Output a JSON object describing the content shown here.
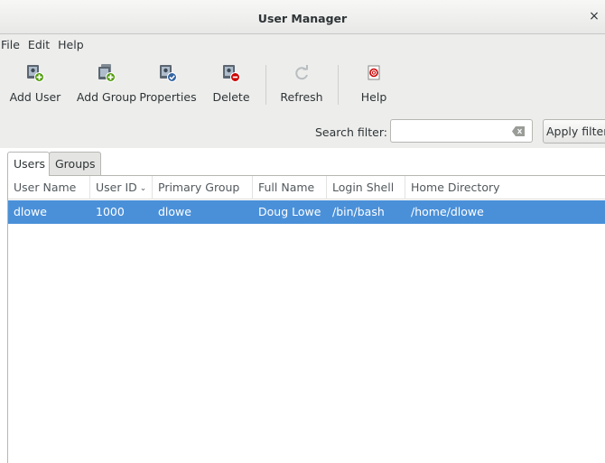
{
  "window": {
    "title": "User Manager",
    "close_glyph": "×"
  },
  "menubar": {
    "items": [
      "File",
      "Edit",
      "Help"
    ]
  },
  "toolbar": {
    "buttons": [
      {
        "label": "Add User",
        "icon": "add-user-icon"
      },
      {
        "label": "Add Group",
        "icon": "add-group-icon"
      },
      {
        "label": "Properties",
        "icon": "properties-icon"
      },
      {
        "label": "Delete",
        "icon": "delete-icon"
      },
      {
        "label": "Refresh",
        "icon": "refresh-icon"
      },
      {
        "label": "Help",
        "icon": "help-icon"
      }
    ]
  },
  "filter": {
    "label": "Search filter:",
    "value": "",
    "apply_label": "Apply filter"
  },
  "tabs": [
    "Users",
    "Groups"
  ],
  "active_tab": "Users",
  "table": {
    "columns": [
      "User Name",
      "User ID",
      "Primary Group",
      "Full Name",
      "Login Shell",
      "Home Directory"
    ],
    "sort_column": "User ID",
    "sort_glyph": "⌄",
    "rows": [
      [
        "dlowe",
        "1000",
        "dlowe",
        "Doug Lowe",
        "/bin/bash",
        "/home/dlowe"
      ]
    ],
    "selected_row": 0
  },
  "colors": {
    "selection": "#4a90d9",
    "toolbar_bg": "#ededec"
  }
}
